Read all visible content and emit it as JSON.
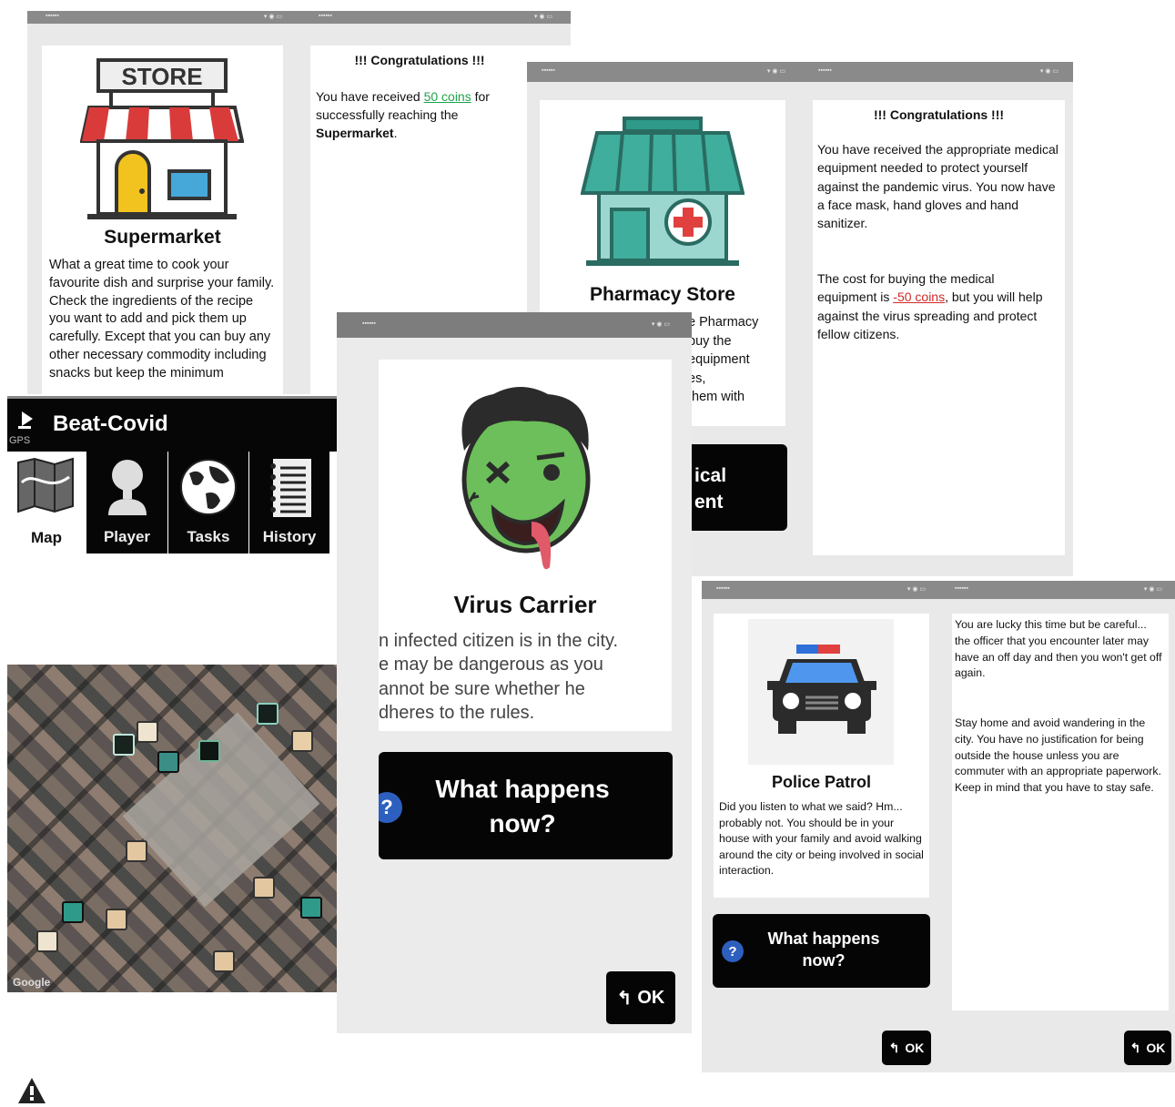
{
  "supermarket": {
    "store_sign": "STORE",
    "title": "Supermarket",
    "description": "What a great time to cook your favourite dish and surprise your family. Check the ingredients of the recipe you want to add and pick them up carefully. Except that you can buy any other necessary commodity including snacks but keep the minimum"
  },
  "congrats1": {
    "heading": "!!! Congratulations !!!",
    "pre": "You have received ",
    "coins": "50 coins",
    "mid": " for successfully reaching the ",
    "place": "Supermarket",
    "end": "."
  },
  "pharmacy": {
    "title": "Pharmacy Store",
    "partial_lines": [
      "e Pharmacy",
      "buy the",
      "equipment",
      "es,",
      "them with"
    ],
    "button_partial": [
      "ical",
      "ent"
    ]
  },
  "congrats2": {
    "heading": "!!! Congratulations !!!",
    "para1": "You have received the appropriate medical equipment needed to protect yourself against the pandemic virus. You now have a face mask, hand gloves and hand sanitizer.",
    "para2_pre": "The cost for buying the medical equipment is ",
    "cost": "-50 coins",
    "para2_post": ", but you will help against the virus spreading and protect fellow citizens."
  },
  "app": {
    "gps_label": "GPS",
    "title": "Beat-Covid",
    "tabs": [
      {
        "label": "Map",
        "icon": "map-icon",
        "active": true
      },
      {
        "label": "Player",
        "icon": "player-icon",
        "active": false
      },
      {
        "label": "Tasks",
        "icon": "globe-icon",
        "active": false
      },
      {
        "label": "History",
        "icon": "notebook-icon",
        "active": false
      }
    ],
    "map_attribution": "Google"
  },
  "virus": {
    "title": "Virus Carrier",
    "lines": [
      "n infected citizen is in the city.",
      "e may be dangerous as you",
      "annot be sure whether he",
      "dheres to the rules."
    ],
    "question": "What happens now?",
    "ok": "OK"
  },
  "police": {
    "title": "Police Patrol",
    "description": "Did you listen to what we said? Hm... probably not. You should be in your house with your family and avoid walking around the city or being involved in social interaction.",
    "question": "What happens now?",
    "ok": "OK"
  },
  "police_msg": {
    "para1": "You are lucky this time but be careful... the officer that you encounter later may have an off day and then you won't get off again.",
    "para2": "Stay home and avoid wandering in the city. You have no justification for being outside the house unless you are commuter with an appropriate paperwork. Keep in mind that you have to stay safe.",
    "ok": "OK"
  },
  "colors": {
    "awning_red": "#d93b3b",
    "pharmacy_teal": "#2f9a8a",
    "zombie_green": "#6cbf5a",
    "police_blue": "#2f6fd8"
  }
}
